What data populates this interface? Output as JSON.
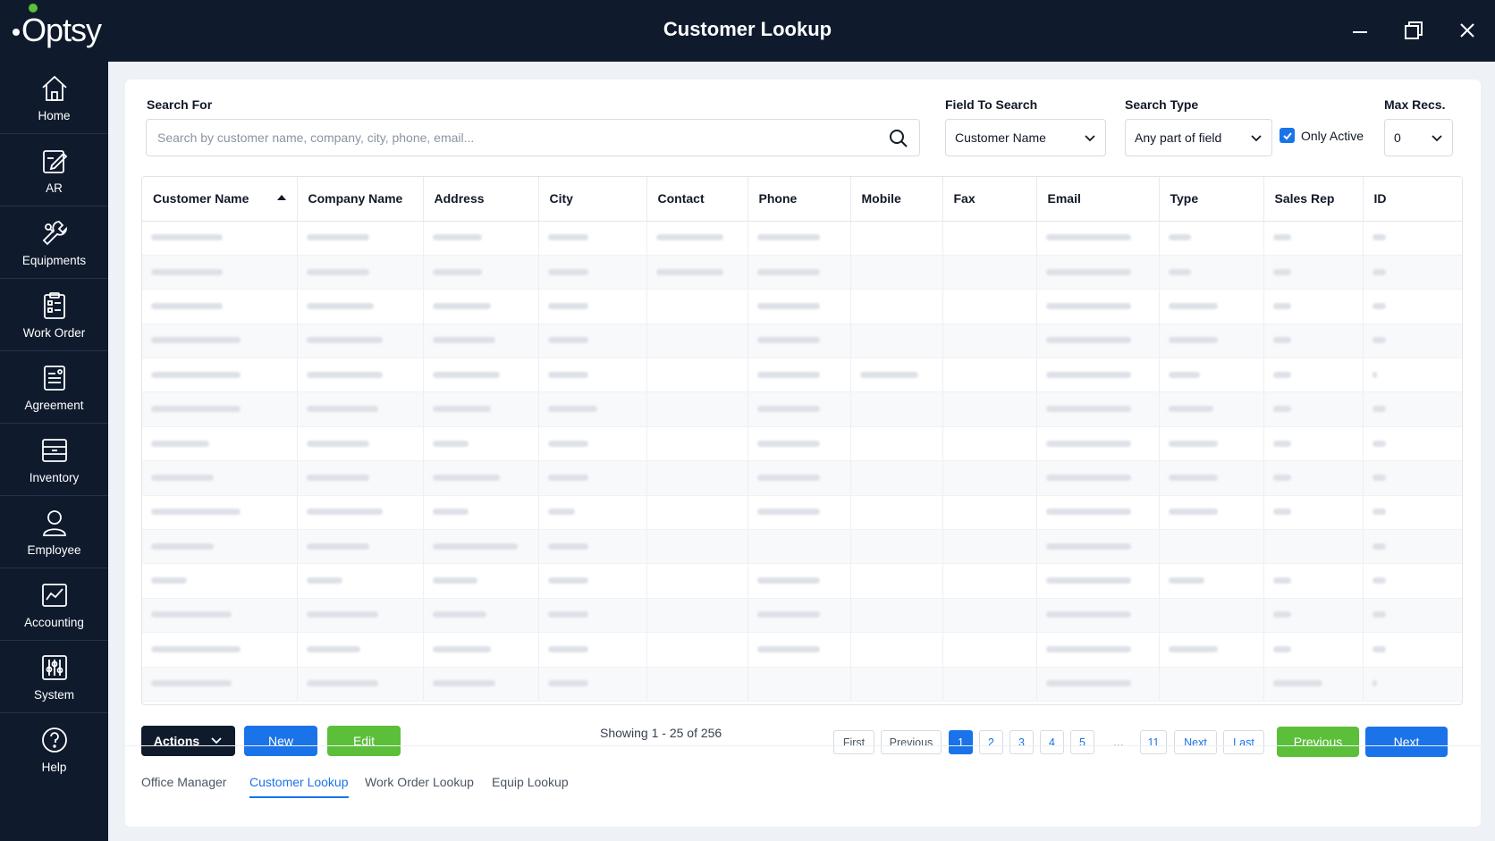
{
  "app": {
    "logo_text": "Optsy",
    "window_title": "Customer Lookup"
  },
  "sidebar": {
    "items": [
      {
        "label": "Home",
        "icon": "home-icon"
      },
      {
        "label": "AR",
        "icon": "edit-icon"
      },
      {
        "label": "Equipments",
        "icon": "wrench-icon"
      },
      {
        "label": "Work Order",
        "icon": "clipboard-icon"
      },
      {
        "label": "Agreement",
        "icon": "document-icon"
      },
      {
        "label": "Inventory",
        "icon": "inventory-icon"
      },
      {
        "label": "Employee",
        "icon": "person-icon"
      },
      {
        "label": "Accounting",
        "icon": "chart-icon"
      },
      {
        "label": "System",
        "icon": "sliders-icon"
      },
      {
        "label": "Help",
        "icon": "help-icon"
      }
    ]
  },
  "search": {
    "label": "Search For",
    "placeholder": "Search by customer name, company, city, phone, email...",
    "field_label": "Field To Search",
    "field_value": "Customer Name",
    "type_label": "Search Type",
    "type_value": "Any part of field",
    "only_active_label": "Only Active",
    "only_active_checked": true,
    "max_label": "Max Recs.",
    "max_value": "0"
  },
  "table": {
    "columns": [
      "Customer Name",
      "Company Name",
      "Address",
      "City",
      "Contact",
      "Phone",
      "Mobile",
      "Fax",
      "Email",
      "Type",
      "Sales Rep",
      "ID"
    ],
    "sorted_column": "Customer Name",
    "sort_direction": "asc"
  },
  "actions": {
    "actions_label": "Actions",
    "new_label": "New",
    "edit_label": "Edit",
    "showing": "Showing 1 - 25 of 256"
  },
  "pagination": {
    "first": "First",
    "previous": "Previous",
    "pages": [
      "1",
      "2",
      "3",
      "4",
      "5"
    ],
    "ellipsis": "...",
    "last_page": "11",
    "next": "Next",
    "last": "Last",
    "current": "1",
    "big_previous": "Previous",
    "big_next": "Next"
  },
  "tabs": [
    "Office Manager",
    "Customer Lookup",
    "Work Order Lookup",
    "Equip Lookup"
  ],
  "active_tab": "Customer Lookup",
  "colors": {
    "navy": "#0f1b2d",
    "blue": "#1a73e8",
    "green": "#5bbf3a"
  }
}
